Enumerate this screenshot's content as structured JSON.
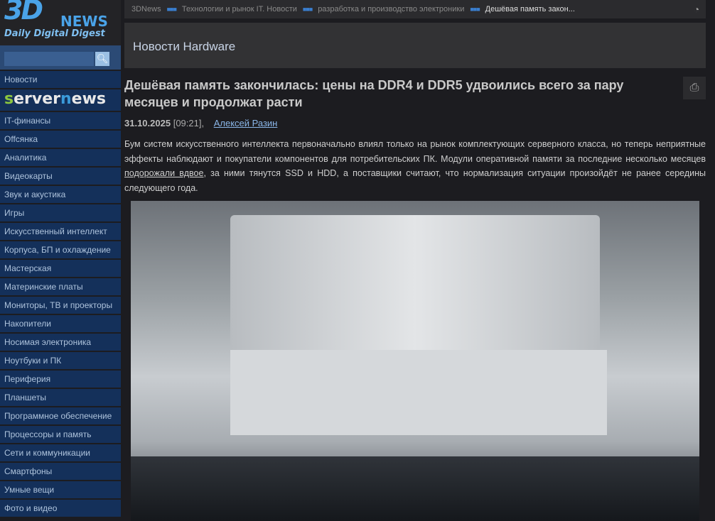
{
  "logo": {
    "big": "3D",
    "news": "NEWS",
    "tagline": "Daily Digital Digest"
  },
  "search": {
    "placeholder": "",
    "icon": "search-icon"
  },
  "sidebar": {
    "items": [
      "Новости",
      "servernews",
      "IT-финансы",
      "Offсянка",
      "Аналитика",
      "Видеокарты",
      "Звук и акустика",
      "Игры",
      "Искусственный интеллект",
      "Корпуса, БП и охлаждение",
      "Мастерская",
      "Материнские платы",
      "Мониторы, ТВ и проекторы",
      "Накопители",
      "Носимая электроника",
      "Ноутбуки и ПК",
      "Периферия",
      "Планшеты",
      "Программное обеспечение",
      "Процессоры и память",
      "Сети и коммуникации",
      "Смартфоны",
      "Умные вещи",
      "Фото и видео"
    ]
  },
  "breadcrumb": [
    "3DNews",
    "Технологии и рынок IT. Новости",
    "разработка и производство электроники",
    "Дешёвая память закон..."
  ],
  "section_title": "Новости Hardware",
  "article": {
    "title": "Дешёвая память закончилась: цены на DDR4 и DDR5 удвоились всего за пару месяцев и продолжат расти",
    "date": "31.10.2025",
    "time": "[09:21],",
    "author": "Алексей Разин",
    "lead_before": "Бум систем искусственного интеллекта первоначально влиял только на рынок комплектующих серверного класса, но теперь неприятные эффекты наблюдают и покупатели компонентов для потребительских ПК. Модули оперативной памяти за последние несколько месяцев ",
    "lead_link": "подорожали вдвое",
    "lead_after": ", за ними тянутся SSD и HDD, а поставщики считают, что нормализация ситуации произойдёт не ранее середины следующего года."
  },
  "colors": {
    "accent": "#4aa3e8",
    "sidebar": "#14305a",
    "background": "#1c1c20"
  }
}
